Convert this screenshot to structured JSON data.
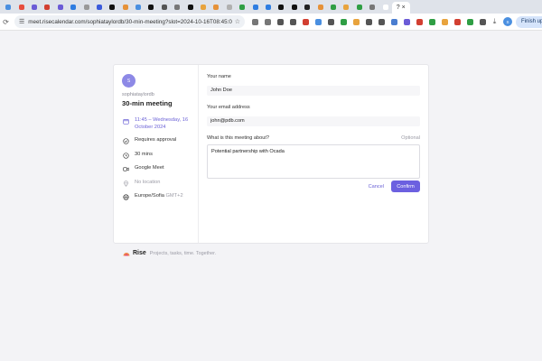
{
  "browser": {
    "tab_favicon_colors": [
      "#4a8fe0",
      "#e74c3c",
      "#6b5bd6",
      "#d23f31",
      "#6b5bd6",
      "#2f7de1",
      "#999999",
      "#3b5bdb",
      "#111111",
      "#e69138",
      "#4a8fe0",
      "#111111",
      "#555555",
      "#777777",
      "#111111",
      "#e8a33d",
      "#e69138",
      "#b0b0b0",
      "#2f9e44",
      "#2f7de1",
      "#2f7de1",
      "#111111",
      "#111111",
      "#222222",
      "#e69138",
      "#2f9e44",
      "#e8a33d",
      "#2f9e44",
      "#777777",
      "#ffffff"
    ],
    "active_tab_label": "?",
    "active_tab_close": "×",
    "url": "meet.risecalendar.com/sophiataylordb/30-min-meeting?slot=2024-10-16T08:45:0...",
    "extension_colors": [
      "#777777",
      "#777777",
      "#555555",
      "#555555",
      "#d23f31",
      "#4a8fe0",
      "#555555",
      "#2f9e44",
      "#e8a33d",
      "#555555",
      "#555555",
      "#4a7dd0",
      "#6b5bd6",
      "#d23f31",
      "#2f9e44",
      "#e8a33d",
      "#d23f31",
      "#2f9e44",
      "#555555"
    ],
    "profile_initial": "S",
    "finish_update_label": "Finish up"
  },
  "sidebar": {
    "avatar_initial": "S",
    "host": "sophiataylordb",
    "title": "30-min meeting",
    "time_line1": "11:45 – Wednesday, 16",
    "time_line2": "October 2024",
    "approval": "Requires approval",
    "duration": "30 mins",
    "platform": "Google Meet",
    "location": "No location",
    "timezone": "Europe/Sofia",
    "timezone_offset": "GMT+2"
  },
  "form": {
    "name_label": "Your name",
    "name_value": "John Doe",
    "email_label": "Your email address",
    "email_value": "john@pdb.com",
    "about_label": "What is this meeting about?",
    "about_optional": "Optional",
    "about_value": "Potential partnership with Ocada",
    "cancel_label": "Cancel",
    "confirm_label": "Confirm"
  },
  "footer": {
    "brand": "Rise",
    "tagline": "Projects, tasks, time. Together."
  },
  "colors": {
    "accent": "#6c60e0",
    "avatar": "#8d89e6",
    "background": "#f3f3f6"
  }
}
